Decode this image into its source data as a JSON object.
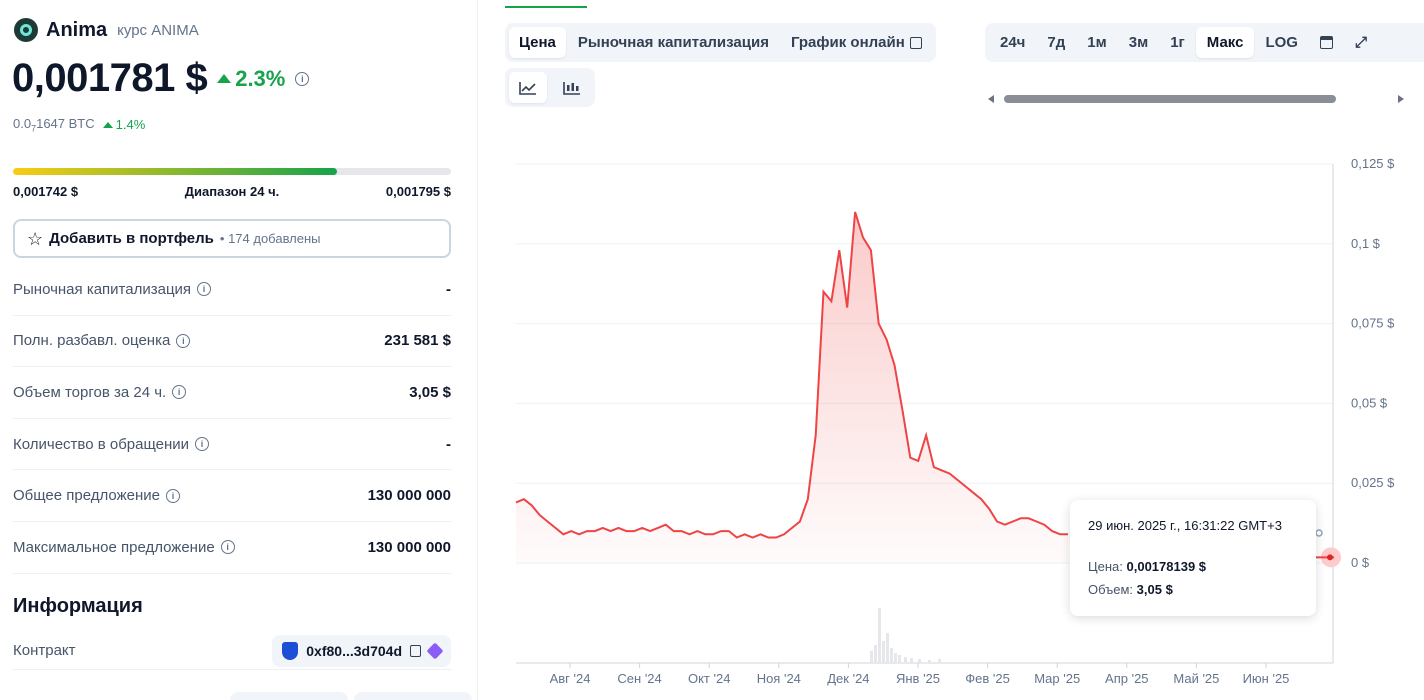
{
  "coin": {
    "name": "Anima",
    "subtitle": "курс ANIMA",
    "price": "0,001781 $",
    "change": "2.3%",
    "btc_price_prefix": "0.0",
    "btc_price_sub": "7",
    "btc_price_suffix": "1647 BTC",
    "btc_change": "1.4%"
  },
  "range": {
    "low": "0,001742 $",
    "label": "Диапазон 24 ч.",
    "high": "0,001795 $",
    "position_fraction": 0.74
  },
  "portfolio": {
    "button_label": "Добавить в портфель",
    "added_text": "• 174 добавлены"
  },
  "stats": [
    {
      "label": "Рыночная капитализация",
      "value": "-"
    },
    {
      "label": "Полн. разбавл. оценка",
      "value": "231 581 $"
    },
    {
      "label": "Объем торгов за 24 ч.",
      "value": "3,05 $"
    },
    {
      "label": "Количество в обращении",
      "value": "-"
    },
    {
      "label": "Общее предложение",
      "value": "130 000 000"
    },
    {
      "label": "Максимальное предложение",
      "value": "130 000 000"
    }
  ],
  "info": {
    "title": "Информация",
    "contract_label": "Контракт",
    "contract_address": "0xf80...3d704d"
  },
  "chart_tabs": {
    "price": "Цена",
    "market_cap": "Рыночная капитализация",
    "live_chart": "График онлайн"
  },
  "range_tabs": [
    "24ч",
    "7д",
    "1м",
    "3м",
    "1г",
    "Макс",
    "LOG"
  ],
  "active_range": "Макс",
  "tooltip": {
    "date": "29 июн. 2025 г., 16:31:22 GMT+3",
    "price_label": "Цена:",
    "price_value": "0,00178139 $",
    "volume_label": "Объем:",
    "volume_value": "3,05 $"
  },
  "colors": {
    "accent_green": "#16a34a",
    "line_red": "#ef4444"
  },
  "chart_data": {
    "type": "area",
    "y_ticks": [
      "0,125 $",
      "0,1 $",
      "0,075 $",
      "0,05 $",
      "0,025 $",
      "0 $"
    ],
    "ylim": [
      0,
      0.125
    ],
    "x_ticks": [
      "Авг '24",
      "Сен '24",
      "Окт '24",
      "Ноя '24",
      "Дек '24",
      "Янв '25",
      "Фев '25",
      "Мар '25",
      "Апр '25",
      "Май '25",
      "Июн '25"
    ],
    "series": [
      {
        "values": [
          0.019,
          0.02,
          0.018,
          0.015,
          0.013,
          0.011,
          0.009,
          0.01,
          0.009,
          0.01,
          0.01,
          0.011,
          0.01,
          0.011,
          0.01,
          0.01,
          0.011,
          0.01,
          0.011,
          0.012,
          0.01,
          0.01,
          0.009,
          0.01,
          0.009,
          0.009,
          0.01,
          0.01,
          0.008,
          0.009,
          0.008,
          0.009,
          0.008,
          0.008,
          0.009,
          0.011,
          0.013,
          0.02,
          0.04,
          0.085,
          0.082,
          0.098,
          0.08,
          0.11,
          0.102,
          0.098,
          0.075,
          0.07,
          0.062,
          0.048,
          0.033,
          0.032,
          0.04,
          0.03,
          0.029,
          0.028,
          0.026,
          0.024,
          0.022,
          0.02,
          0.017,
          0.013,
          0.012,
          0.013,
          0.014,
          0.014,
          0.013,
          0.012,
          0.01,
          0.009,
          0.009
        ]
      }
    ],
    "last_value": 0.00178139,
    "grid": true
  }
}
